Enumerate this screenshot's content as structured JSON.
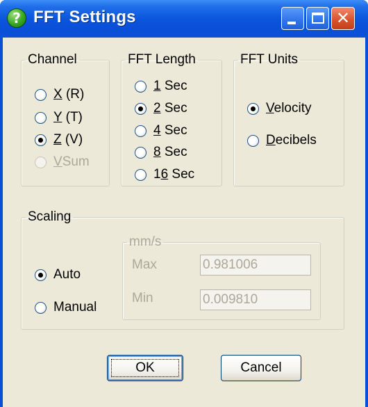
{
  "window": {
    "title": "FFT Settings",
    "icon_glyph": "?",
    "buttons": {
      "minimize": "minimize-icon",
      "maximize": "maximize-icon",
      "close_glyph": "✕"
    }
  },
  "channel": {
    "legend": "Channel",
    "options": [
      {
        "accel": "X",
        "rest": " (R)",
        "checked": false,
        "enabled": true
      },
      {
        "accel": "Y",
        "rest": " (T)",
        "checked": false,
        "enabled": true
      },
      {
        "accel": "Z",
        "rest": " (V)",
        "checked": true,
        "enabled": true
      },
      {
        "accel": "V",
        "rest": "Sum",
        "checked": false,
        "enabled": false
      }
    ]
  },
  "fft_length": {
    "legend": "FFT Length",
    "options": [
      {
        "accel": "1",
        "rest": " Sec",
        "pre": "",
        "checked": false
      },
      {
        "accel": "2",
        "rest": " Sec",
        "pre": "",
        "checked": true
      },
      {
        "accel": "4",
        "rest": " Sec",
        "pre": "",
        "checked": false
      },
      {
        "accel": "8",
        "rest": " Sec",
        "pre": "",
        "checked": false
      },
      {
        "accel": "6",
        "rest": " Sec",
        "pre": "1",
        "checked": false
      }
    ]
  },
  "fft_units": {
    "legend": "FFT Units",
    "options": [
      {
        "accel": "V",
        "rest": "elocity",
        "checked": true
      },
      {
        "accel": "D",
        "rest": "ecibels",
        "checked": false
      }
    ]
  },
  "scaling": {
    "legend": "Scaling",
    "auto_label": "Auto",
    "manual_label": "Manual",
    "mode": "Auto",
    "units_legend": "mm/s",
    "max_label": "Max",
    "max_value": "0.981006",
    "min_label": "Min",
    "min_value": "0.009810"
  },
  "buttons": {
    "ok": "OK",
    "cancel": "Cancel"
  },
  "colors": {
    "title_bar": "#0a4fd8",
    "dialog_face": "#ece9d8",
    "selected_radio_dot": "#21a121",
    "disabled_text": "#aca899",
    "close_button": "#d9542e"
  }
}
